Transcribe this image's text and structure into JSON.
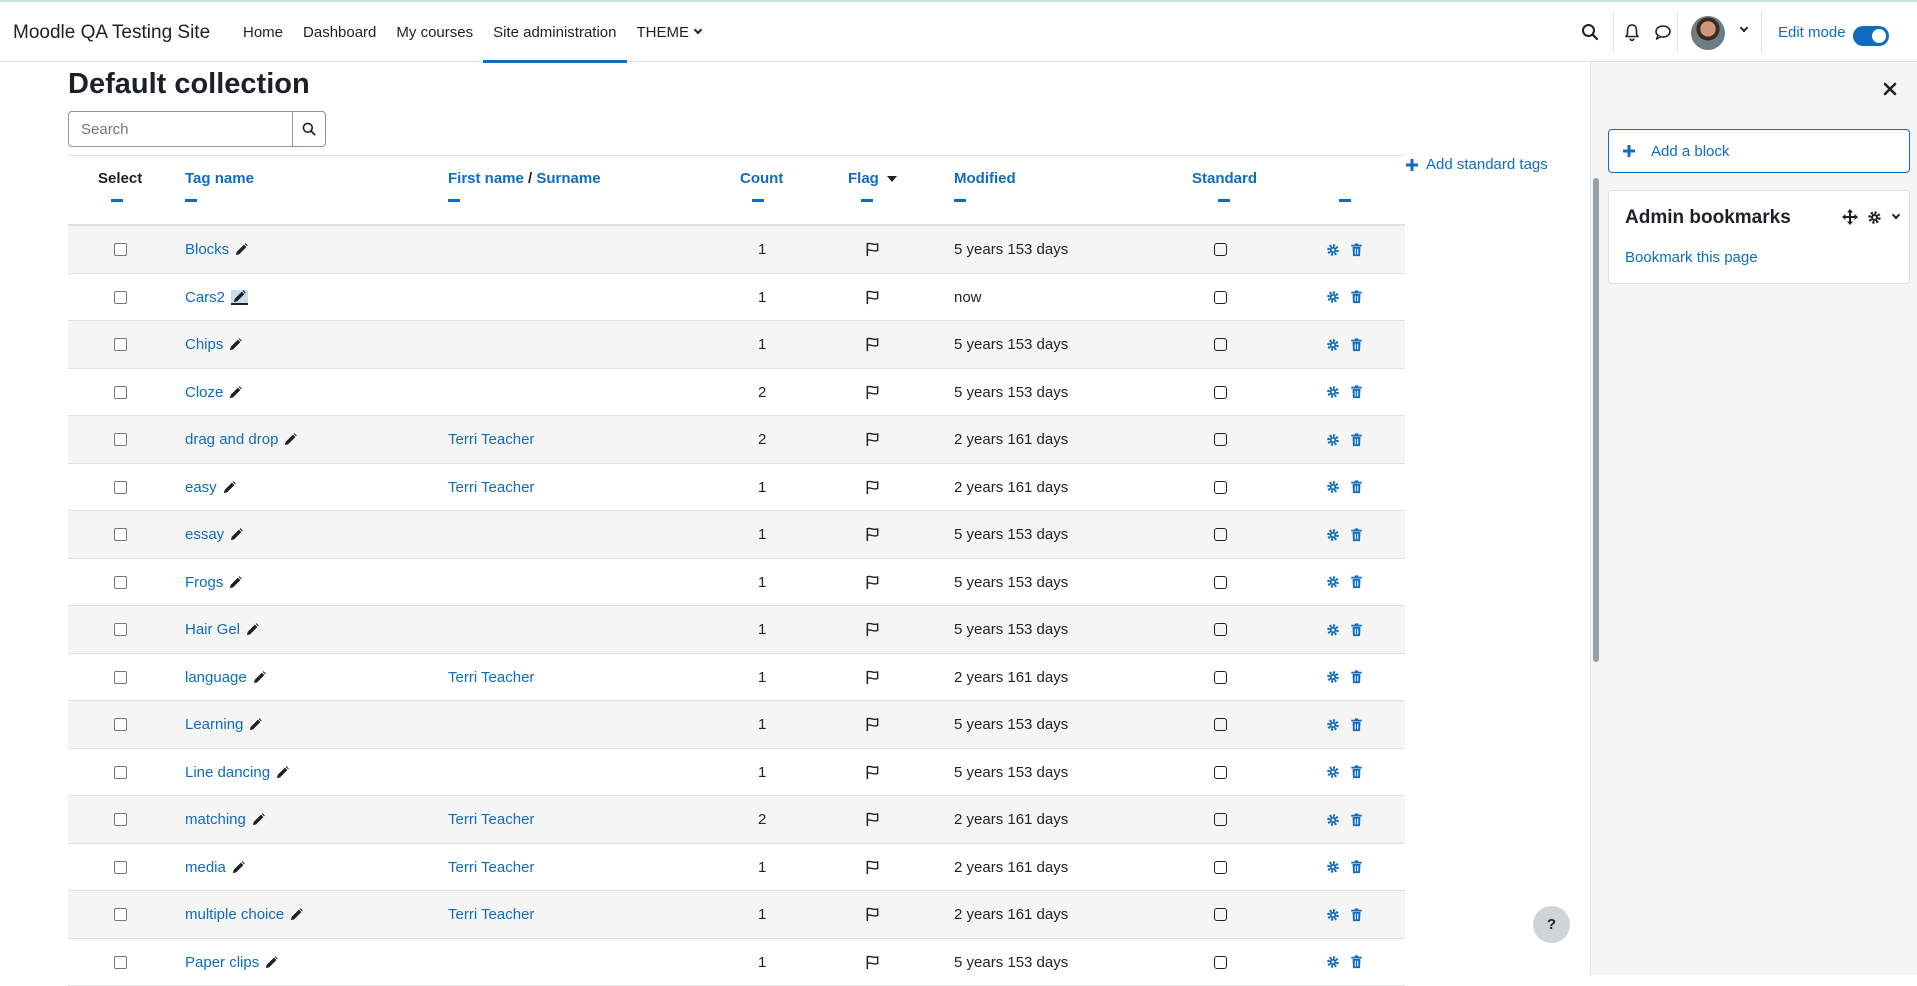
{
  "site": {
    "brand": "Moodle QA Testing Site"
  },
  "nav": {
    "items": [
      {
        "label": "Home",
        "active": false
      },
      {
        "label": "Dashboard",
        "active": false
      },
      {
        "label": "My courses",
        "active": false
      },
      {
        "label": "Site administration",
        "active": true
      },
      {
        "label": "THEME",
        "active": false
      }
    ],
    "edit_mode_label": "Edit mode",
    "edit_mode_on": true
  },
  "page": {
    "title": "Default collection",
    "search_placeholder": "Search",
    "add_standard_tags": "Add standard tags"
  },
  "table": {
    "headers": {
      "select": "Select",
      "tag_name": "Tag name",
      "first_name": "First name",
      "name_sep": " / ",
      "surname": "Surname",
      "count": "Count",
      "flag": "Flag",
      "modified": "Modified",
      "standard": "Standard"
    },
    "rows": [
      {
        "tag": "Blocks",
        "user": "",
        "count": "1",
        "modified": "5 years 153 days"
      },
      {
        "tag": "Cars2",
        "user": "",
        "count": "1",
        "modified": "now",
        "highlight": true
      },
      {
        "tag": "Chips",
        "user": "",
        "count": "1",
        "modified": "5 years 153 days"
      },
      {
        "tag": "Cloze",
        "user": "",
        "count": "2",
        "modified": "5 years 153 days"
      },
      {
        "tag": "drag and drop",
        "user": "Terri Teacher",
        "count": "2",
        "modified": "2 years 161 days"
      },
      {
        "tag": "easy",
        "user": "Terri Teacher",
        "count": "1",
        "modified": "2 years 161 days"
      },
      {
        "tag": "essay",
        "user": "",
        "count": "1",
        "modified": "5 years 153 days"
      },
      {
        "tag": "Frogs",
        "user": "",
        "count": "1",
        "modified": "5 years 153 days"
      },
      {
        "tag": "Hair Gel",
        "user": "",
        "count": "1",
        "modified": "5 years 153 days"
      },
      {
        "tag": "language",
        "user": "Terri Teacher",
        "count": "1",
        "modified": "2 years 161 days"
      },
      {
        "tag": "Learning",
        "user": "",
        "count": "1",
        "modified": "5 years 153 days"
      },
      {
        "tag": "Line dancing",
        "user": "",
        "count": "1",
        "modified": "5 years 153 days"
      },
      {
        "tag": "matching",
        "user": "Terri Teacher",
        "count": "2",
        "modified": "2 years 161 days"
      },
      {
        "tag": "media",
        "user": "Terri Teacher",
        "count": "1",
        "modified": "2 years 161 days"
      },
      {
        "tag": "multiple choice",
        "user": "Terri Teacher",
        "count": "1",
        "modified": "2 years 161 days"
      },
      {
        "tag": "Paper clips",
        "user": "",
        "count": "1",
        "modified": "5 years 153 days"
      }
    ]
  },
  "drawer": {
    "add_block": "Add a block",
    "bookmarks_title": "Admin bookmarks",
    "bookmark_link": "Bookmark this page"
  },
  "help": {
    "label": "?"
  },
  "colors": {
    "link": "#0f6cbf",
    "stripe": "#f5f5f5",
    "border": "#dee2e6"
  }
}
